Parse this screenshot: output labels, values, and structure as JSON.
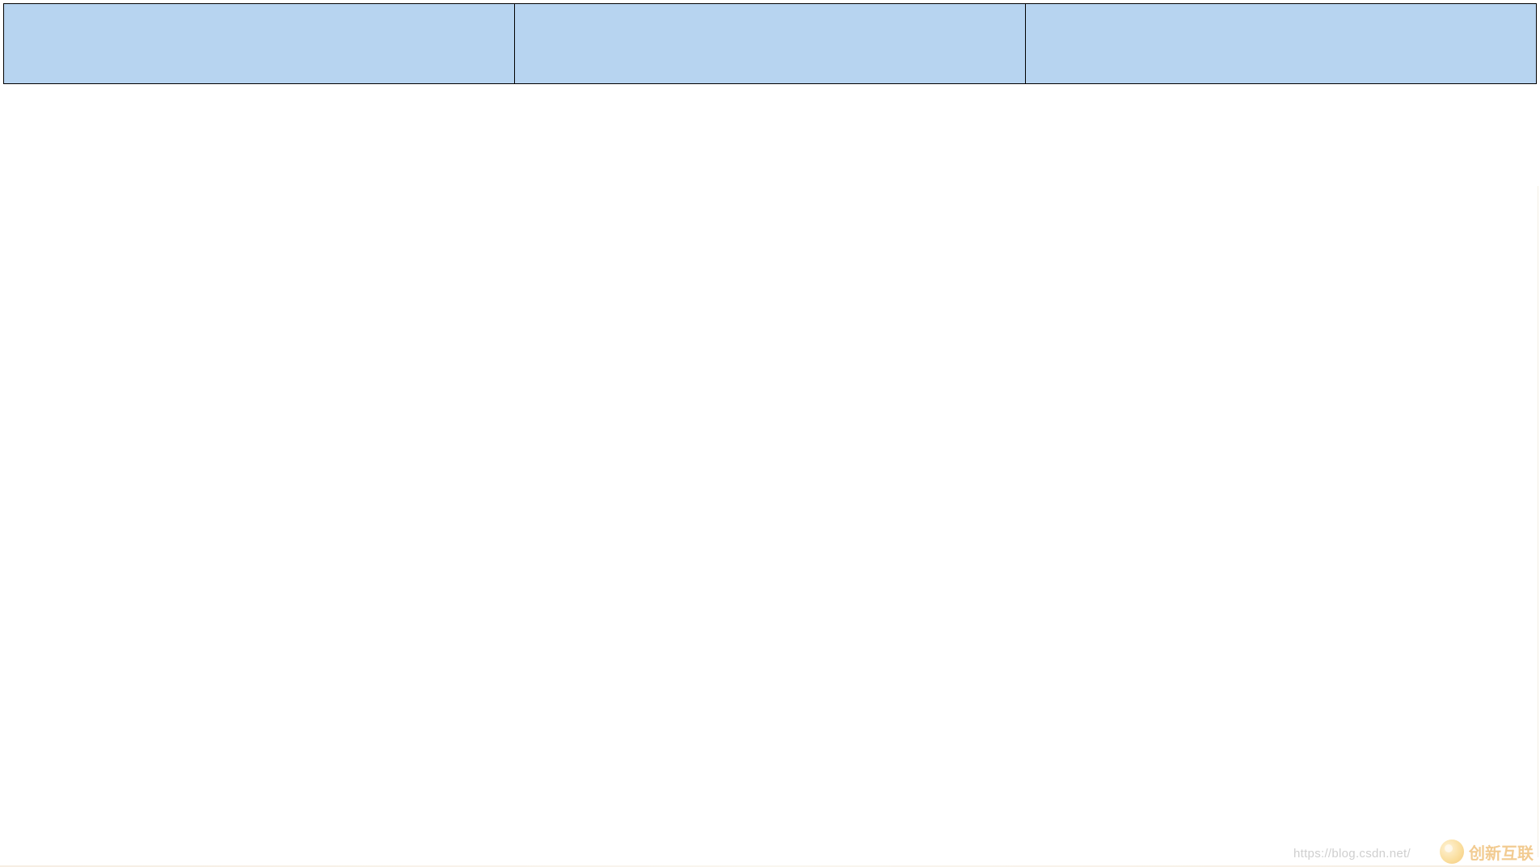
{
  "table": {
    "headers": [
      "",
      "",
      ""
    ]
  },
  "watermark": {
    "url_text": "https://blog.csdn.net/",
    "logo_label": "创新互联"
  }
}
